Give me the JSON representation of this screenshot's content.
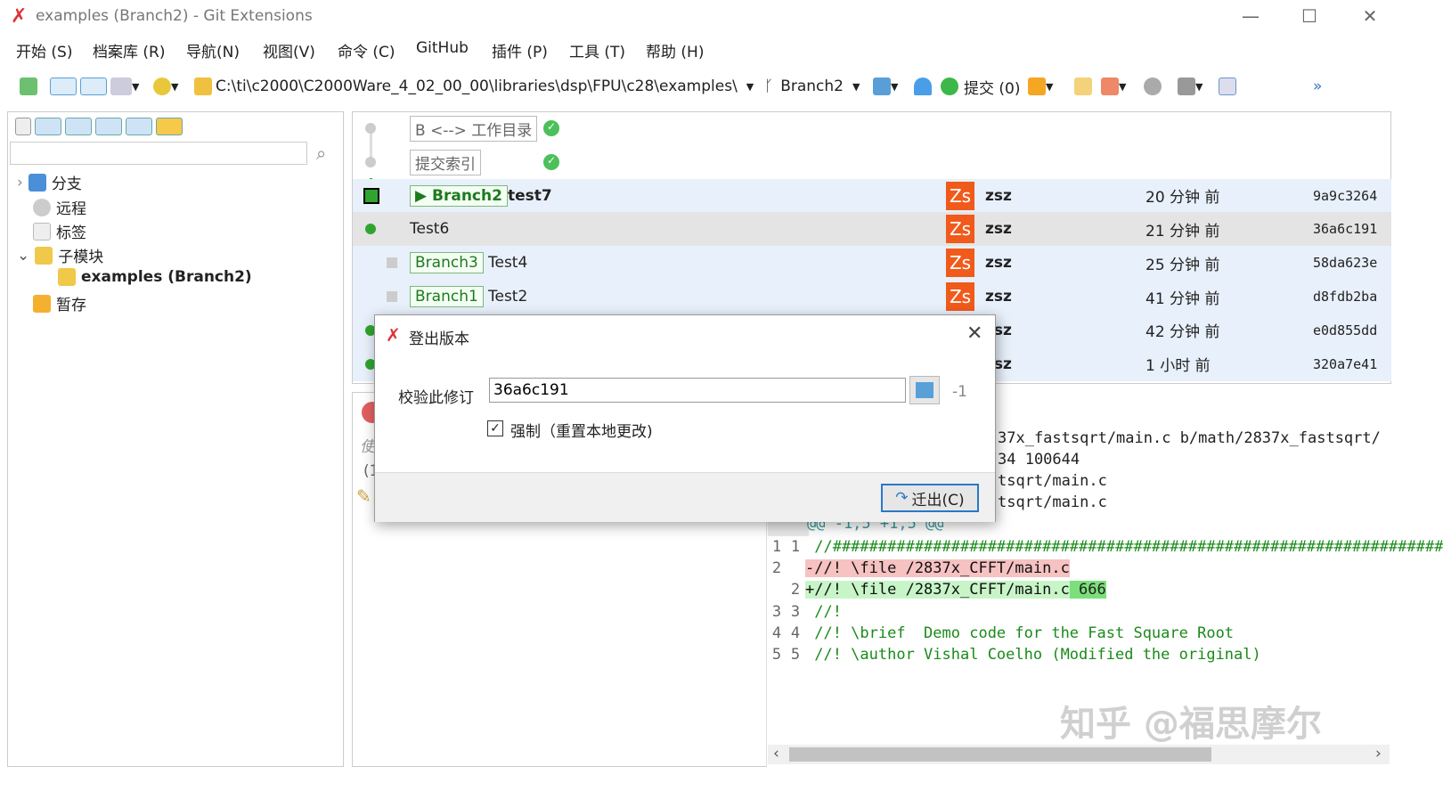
{
  "window": {
    "title": "examples (Branch2) - Git Extensions",
    "minimize": "—",
    "maximize": "☐",
    "close": "✕"
  },
  "menu": [
    "开始 (S)",
    "档案库 (R)",
    "导航(N)",
    "视图(V)",
    "命令 (C)",
    "GitHub",
    "插件 (P)",
    "工具 (T)",
    "帮助 (H)"
  ],
  "toolbar": {
    "path": "C:\\ti\\c2000\\C2000Ware_4_02_00_00\\libraries\\dsp\\FPU\\c28\\examples\\",
    "branch": "Branch2",
    "commit": "提交 (0)",
    "overflow": "»"
  },
  "left": {
    "search_placeholder": "",
    "tree": [
      {
        "label": "分支",
        "bold": false
      },
      {
        "label": "远程",
        "bold": false
      },
      {
        "label": "标签",
        "bold": false
      },
      {
        "label": "子模块",
        "bold": false
      },
      {
        "label": "examples (Branch2)",
        "bold": true
      },
      {
        "label": "暂存",
        "bold": false
      }
    ]
  },
  "graph": {
    "rows": [
      {
        "tag": "B <--> 工作目录",
        "kind": "worktree"
      },
      {
        "tag": "提交索引",
        "kind": "index"
      },
      {
        "branch": "Branch2",
        "message": "test7",
        "author": "zsz",
        "date": "20 分钟 前",
        "hash": "9a9c3264",
        "avatar": "Zs"
      },
      {
        "message": "Test6",
        "author": "zsz",
        "date": "21 分钟 前",
        "hash": "36a6c191",
        "avatar": "Zs"
      },
      {
        "branch": "Branch3",
        "message": "Test4",
        "author": "zsz",
        "date": "25 分钟 前",
        "hash": "58da623e",
        "avatar": "Zs"
      },
      {
        "branch": "Branch1",
        "message": "Test2",
        "author": "zsz",
        "date": "41 分钟 前",
        "hash": "d8fdb2ba",
        "avatar": "Zs"
      },
      {
        "author": "zsz",
        "date": "42 分钟 前",
        "hash": "e0d855dd",
        "avatar": "Zs"
      },
      {
        "author": "zsz",
        "date": "1 小时 前",
        "hash": "320a7e41",
        "avatar": "Zs"
      }
    ]
  },
  "lower_left": {
    "italic": "使",
    "paren": "(1"
  },
  "diff": {
    "header": [
      "37x_fastsqrt/main.c b/math/2837x_fastsqrt/",
      "34 100644",
      "tsqrt/main.c",
      "tsqrt/main.c"
    ],
    "hunk": "@@ -1,5 +1,5 @@",
    "lines": [
      {
        "old": "1",
        "new": "1",
        "text": " //###################################################################",
        "type": "ctx"
      },
      {
        "old": "2",
        "new": "",
        "text": "-//! \\file /2837x_CFFT/main.c",
        "type": "del"
      },
      {
        "old": "",
        "new": "2",
        "text": "+//! \\file /2837x_CFFT/main.c",
        "extra": " 666",
        "type": "add"
      },
      {
        "old": "3",
        "new": "3",
        "text": " //!",
        "type": "ctx"
      },
      {
        "old": "4",
        "new": "4",
        "text": " //! \\brief  Demo code for the Fast Square Root",
        "type": "ctx"
      },
      {
        "old": "5",
        "new": "5",
        "text": " //! \\author Vishal Coelho (Modified the original)",
        "type": "ctx"
      }
    ]
  },
  "dialog": {
    "title": "登出版本",
    "label": "校验此修订",
    "revision": "36a6c191",
    "offset": "-1",
    "force_label": "强制（重置本地更改)",
    "force_checked": true,
    "ok": "迁出(C)"
  },
  "watermark": "知乎 @福思摩尔",
  "colors": {
    "accent": "#2fa52f",
    "avatar": "#f05a1a",
    "del": "#f6c2c2",
    "add": "#c8f5c8"
  }
}
